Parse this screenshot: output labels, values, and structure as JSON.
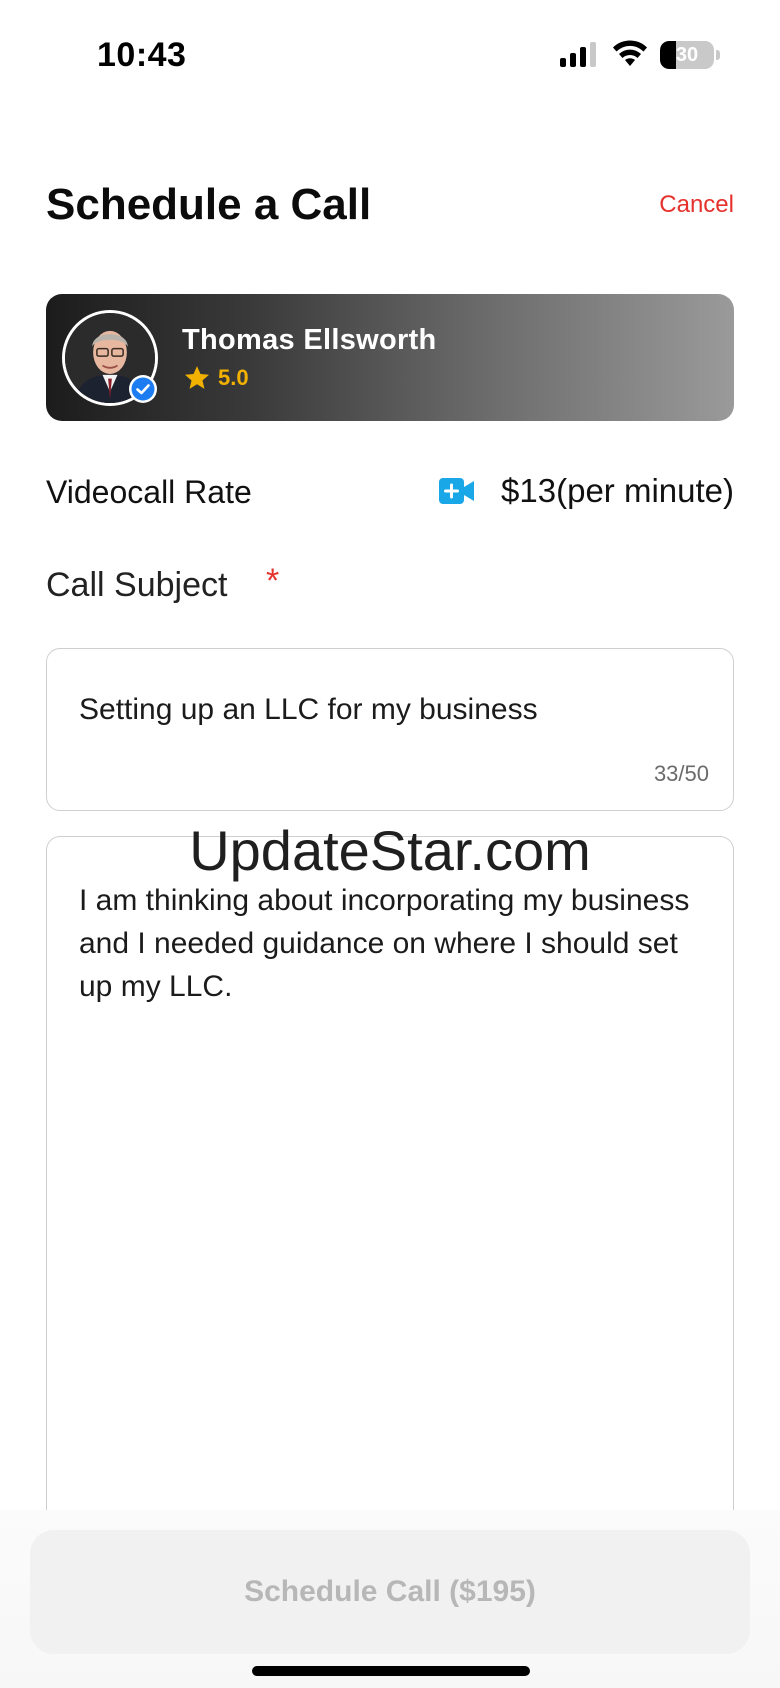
{
  "status_bar": {
    "time": "10:43",
    "battery_percent": "30",
    "battery_level": 0.3
  },
  "header": {
    "title": "Schedule a Call",
    "cancel_label": "Cancel"
  },
  "expert": {
    "name": "Thomas Ellsworth",
    "rating": "5.0",
    "verified": true
  },
  "rate": {
    "label": "Videocall Rate",
    "icon": "video-camera-add-icon",
    "value": "$13(per minute)"
  },
  "subject": {
    "label": "Call Subject",
    "required_mark": "*",
    "value": "Setting up an LLC for my business",
    "counter": "33/50"
  },
  "description": {
    "value": "I am thinking about incorporating my business and I needed guidance on where I should set up my LLC."
  },
  "watermark": "UpdateStar.com",
  "footer": {
    "schedule_button": "Schedule Call ($195)"
  },
  "colors": {
    "accent_red": "#e5322d",
    "star_gold": "#f2b100",
    "video_icon_blue": "#1aa7e8",
    "verified_blue": "#1d7cf2"
  }
}
